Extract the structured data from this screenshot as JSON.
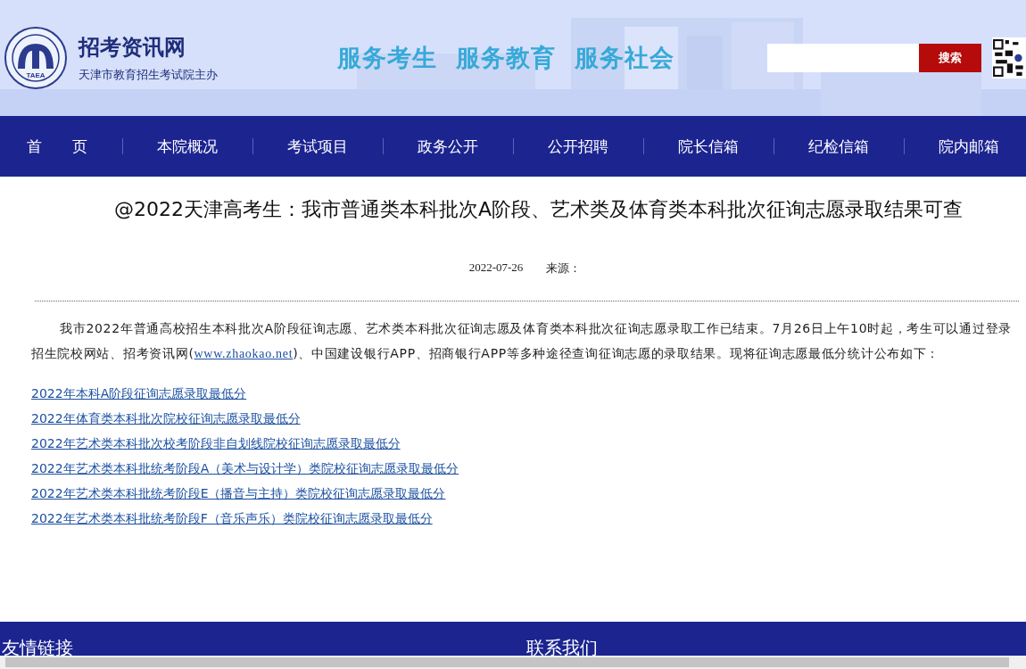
{
  "header": {
    "site_name": "招考资讯网",
    "site_subtitle": "天津市教育招生考试院主办",
    "logo_text": "TAEA",
    "slogan": "服务考生  服务教育  服务社会",
    "search_button": "搜索"
  },
  "nav": [
    {
      "label": "首　　页"
    },
    {
      "label": "本院概况"
    },
    {
      "label": "考试项目"
    },
    {
      "label": "政务公开"
    },
    {
      "label": "公开招聘"
    },
    {
      "label": "院长信箱"
    },
    {
      "label": "纪检信箱"
    },
    {
      "label": "院内邮箱"
    }
  ],
  "article": {
    "title": "@2022天津高考生：我市普通类本科批次A阶段、艺术类及体育类本科批次征询志愿录取结果可查",
    "date": "2022-07-26",
    "source_label": "来源：",
    "paragraph_before": "我市2022年普通高校招生本科批次A阶段征询志愿、艺术类本科批次征询志愿及体育类本科批次征询志愿录取工作已结束。7月26日上午10时起，考生可以通过登录招生院校网站、招考资讯网(",
    "paragraph_link": "www.zhaokao.net",
    "paragraph_after": ")、中国建设银行APP、招商银行APP等多种途径查询征询志愿的录取结果。现将征询志愿最低分统计公布如下：",
    "links": [
      "2022年本科A阶段征询志愿录取最低分",
      "2022年体育类本科批次院校征询志愿录取最低分",
      "2022年艺术类本科批次校考阶段非自划线院校征询志愿录取最低分",
      "2022年艺术类本科批统考阶段A（美术与设计学）类院校征询志愿录取最低分",
      "2022年艺术类本科批统考阶段E（播音与主持）类院校征询志愿录取最低分",
      "2022年艺术类本科批统考阶段F（音乐声乐）类院校征询志愿录取最低分"
    ]
  },
  "footer": {
    "headings": [
      "友情链接",
      "联系我们"
    ]
  }
}
